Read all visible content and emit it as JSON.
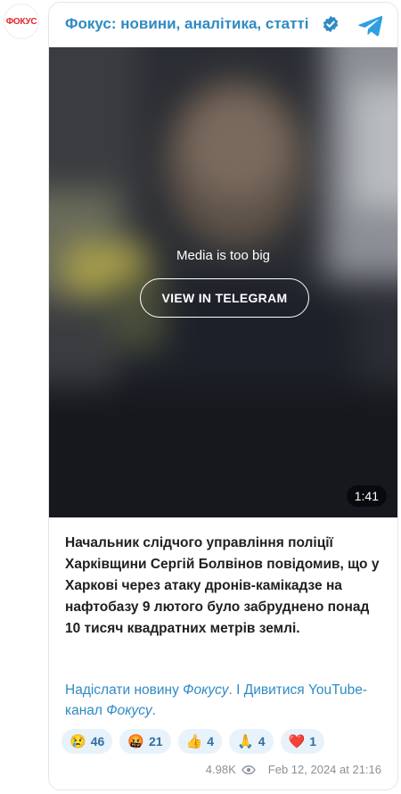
{
  "channel": {
    "logo_text": "ФОКУС",
    "name": "Фокус: новини, аналітика, статті",
    "verified_icon": "verified-badge-icon",
    "platform_icon": "telegram-icon",
    "accent": "#2f8ac4"
  },
  "media": {
    "message": "Media is too big",
    "button_label": "VIEW IN TELEGRAM",
    "duration": "1:41"
  },
  "post": {
    "text": "Начальник слідчого управління поліції Харківщини Сергій Болвінов повідомив, що у Харкові через атаку дронів-камікадзе на нафтобазу 9 лютого було забруднено понад 10 тисяч квадратних метрів землі.",
    "link1_text": "Надіслати новину ",
    "link1_italic": "Фокусу",
    "separator": ". І ",
    "link2_text": "Дивитися YouTube-канал ",
    "link2_italic": "Фокусу",
    "tail": "."
  },
  "reactions": [
    {
      "emoji": "😢",
      "count": "46"
    },
    {
      "emoji": "🤬",
      "count": "21"
    },
    {
      "emoji": "👍",
      "count": "4"
    },
    {
      "emoji": "🙏",
      "count": "4"
    },
    {
      "emoji": "❤️",
      "count": "1"
    }
  ],
  "meta": {
    "views": "4.98K",
    "views_icon": "eye-icon",
    "date": "Feb 12, 2024 at 21:16"
  }
}
